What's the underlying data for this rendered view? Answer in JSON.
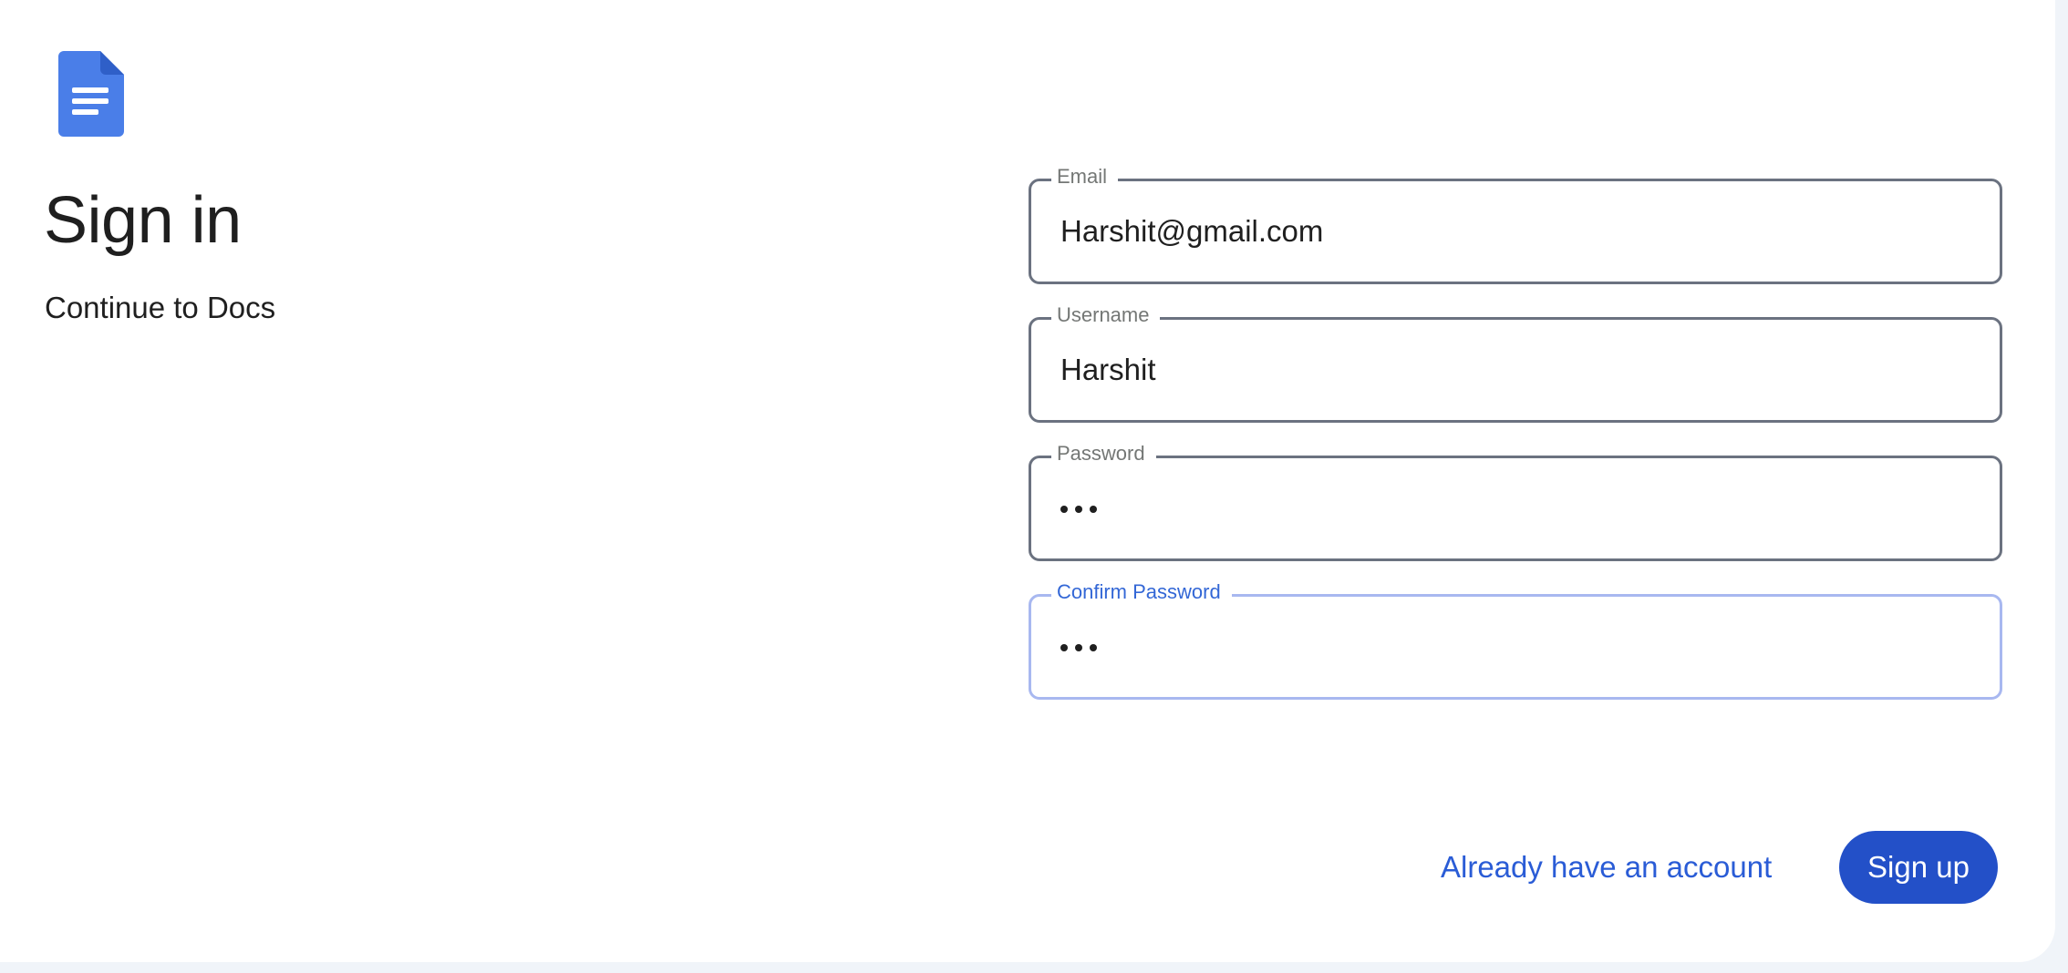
{
  "app": {
    "icon": "google-docs-icon"
  },
  "header": {
    "title": "Sign in",
    "subtitle": "Continue to Docs"
  },
  "form": {
    "email": {
      "label": "Email",
      "value": "Harshit@gmail.com"
    },
    "username": {
      "label": "Username",
      "value": "Harshit"
    },
    "password": {
      "label": "Password",
      "masked_length": 3
    },
    "confirm_password": {
      "label": "Confirm Password",
      "masked_length": 3,
      "focused": true
    }
  },
  "actions": {
    "login_link": "Already have an account",
    "signup_button": "Sign up"
  },
  "colors": {
    "background": "#f0f4f9",
    "card": "#ffffff",
    "primary": "#2350c8",
    "link": "#2a5cd6",
    "focus": "#3367d6",
    "doc_icon": "#4a7ee8"
  }
}
